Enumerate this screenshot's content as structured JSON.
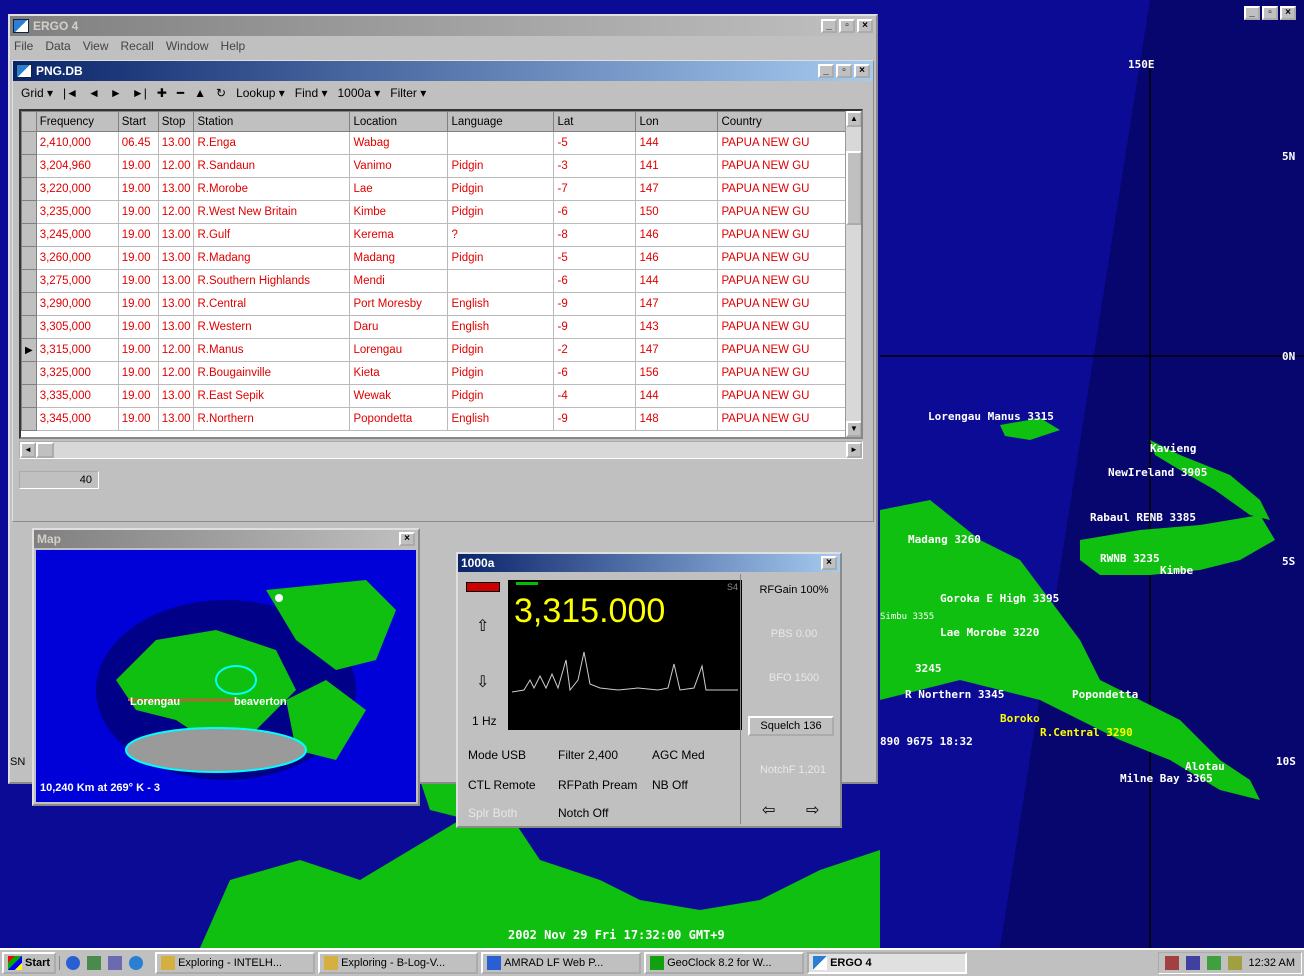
{
  "desktop_map": {
    "grid_labels": [
      "150E",
      "5N",
      "0N",
      "5S",
      "10S"
    ],
    "places": [
      "Lorengau Manus 3315",
      "Kavieng",
      "NewIreland 3905",
      "Rabaul RENB 3385",
      "Madang 3260",
      "RWNB 3235",
      "Kimbe",
      "Goroka E High 3395",
      "Simbu 3355",
      "Lae Morobe 3220",
      "3245",
      "R Northern 3345",
      "Popondetta",
      "Boroko",
      "R.Central 3290",
      "890 9675 18:32",
      "Alotau",
      "Milne Bay 3365"
    ],
    "clock": "2002 Nov 29 Fri 17:32:00 GMT+9"
  },
  "app": {
    "title": "ERGO 4",
    "menu": [
      "File",
      "Data",
      "View",
      "Recall",
      "Window",
      "Help"
    ]
  },
  "db_window": {
    "title": "PNG.DB",
    "toolbar": [
      "Grid",
      "Lookup",
      "Find",
      "1000a",
      "Filter"
    ],
    "columns": [
      "Frequency",
      "Start",
      "Stop",
      "Station",
      "Location",
      "Language",
      "Lat",
      "Lon",
      "Country"
    ],
    "rows": [
      [
        "2,410,000",
        "06.45",
        "13.00",
        "R.Enga",
        "Wabag",
        "",
        "-5",
        "144",
        "PAPUA NEW GU"
      ],
      [
        "3,204,960",
        "19.00",
        "12.00",
        "R.Sandaun",
        "Vanimo",
        "Pidgin",
        "-3",
        "141",
        "PAPUA NEW GU"
      ],
      [
        "3,220,000",
        "19.00",
        "13.00",
        "R.Morobe",
        "Lae",
        "Pidgin",
        "-7",
        "147",
        "PAPUA NEW GU"
      ],
      [
        "3,235,000",
        "19.00",
        "12.00",
        "R.West New Britain",
        "Kimbe",
        "Pidgin",
        "-6",
        "150",
        "PAPUA NEW GU"
      ],
      [
        "3,245,000",
        "19.00",
        "13.00",
        "R.Gulf",
        "Kerema",
        "?",
        "-8",
        "146",
        "PAPUA NEW GU"
      ],
      [
        "3,260,000",
        "19.00",
        "13.00",
        "R.Madang",
        "Madang",
        "Pidgin",
        "-5",
        "146",
        "PAPUA NEW GU"
      ],
      [
        "3,275,000",
        "19.00",
        "13.00",
        "R.Southern Highlands",
        "Mendi",
        "",
        "-6",
        "144",
        "PAPUA NEW GU"
      ],
      [
        "3,290,000",
        "19.00",
        "13.00",
        "R.Central",
        "Port Moresby",
        "English",
        "-9",
        "147",
        "PAPUA NEW GU"
      ],
      [
        "3,305,000",
        "19.00",
        "13.00",
        "R.Western",
        "Daru",
        "English",
        "-9",
        "143",
        "PAPUA NEW GU"
      ],
      [
        "3,315,000",
        "19.00",
        "12.00",
        "R.Manus",
        "Lorengau",
        "Pidgin",
        "-2",
        "147",
        "PAPUA NEW GU"
      ],
      [
        "3,325,000",
        "19.00",
        "12.00",
        "R.Bougainville",
        "Kieta",
        "Pidgin",
        "-6",
        "156",
        "PAPUA NEW GU"
      ],
      [
        "3,335,000",
        "19.00",
        "13.00",
        "R.East Sepik",
        "Wewak",
        "Pidgin",
        "-4",
        "144",
        "PAPUA NEW GU"
      ],
      [
        "3,345,000",
        "19.00",
        "13.00",
        "R.Northern",
        "Popondetta",
        "English",
        "-9",
        "148",
        "PAPUA NEW GU"
      ]
    ],
    "selected_row": 9,
    "record_count": "40"
  },
  "map_window": {
    "title": "Map",
    "from_label": "Lorengau",
    "to_label": "beaverton",
    "distance": "10,240 Km at 269°  K - 3"
  },
  "radio_window": {
    "title": "1000a",
    "frequency": "3,315.000",
    "signal": "S4",
    "step": "1 Hz",
    "mode": "Mode USB",
    "filter": "Filter 2,400",
    "agc": "AGC Med",
    "ctl": "CTL Remote",
    "rfpath": "RFPath Pream",
    "nb": "NB Off",
    "splr": "Splr Both",
    "notch": "Notch Off",
    "rfgain": "RFGain 100%",
    "pbs": "PBS 0.00",
    "bfo": "BFO 1500",
    "squelch": "Squelch 136",
    "notchf": "NotchF 1,201",
    "partial_sn": "SN"
  },
  "taskbar": {
    "start": "Start",
    "tasks": [
      "Exploring - INTELH...",
      "Exploring - B-Log-V...",
      "AMRAD LF Web P...",
      "GeoClock 8.2 for W...",
      "ERGO 4"
    ],
    "clock": "12:32 AM"
  },
  "colors": {
    "titlebar_active": "#0a246a",
    "grid_text": "#e00000",
    "land": "#00cc00",
    "ocean": "#0a0a90",
    "lcd_text": "#ffff00"
  }
}
